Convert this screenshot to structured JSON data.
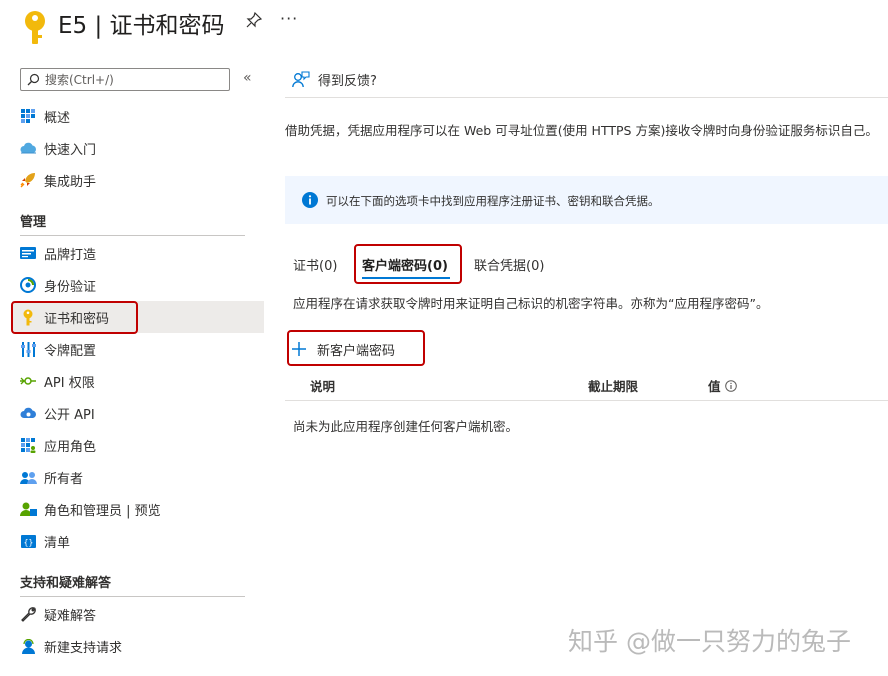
{
  "header": {
    "title": "E5 | 证书和密码",
    "more": "···"
  },
  "sidebar": {
    "search_placeholder": "搜索(Ctrl+/)",
    "collapse": "«",
    "top_items": [
      {
        "label": "概述",
        "icon": "overview-grid-icon"
      },
      {
        "label": "快速入门",
        "icon": "cloud-icon"
      },
      {
        "label": "集成助手",
        "icon": "rocket-icon"
      }
    ],
    "section_manage": "管理",
    "manage_items": [
      {
        "label": "品牌打造",
        "icon": "branding-icon"
      },
      {
        "label": "身份验证",
        "icon": "authentication-icon"
      },
      {
        "label": "证书和密码",
        "icon": "key-icon"
      },
      {
        "label": "令牌配置",
        "icon": "token-config-icon"
      },
      {
        "label": "API 权限",
        "icon": "api-permission-icon"
      },
      {
        "label": "公开 API",
        "icon": "cloud-api-icon"
      },
      {
        "label": "应用角色",
        "icon": "app-roles-icon"
      },
      {
        "label": "所有者",
        "icon": "owners-icon"
      },
      {
        "label": "角色和管理员 | 预览",
        "icon": "roles-admins-icon"
      },
      {
        "label": "清单",
        "icon": "manifest-icon"
      }
    ],
    "section_support": "支持和疑难解答",
    "support_items": [
      {
        "label": "疑难解答",
        "icon": "wrench-icon"
      },
      {
        "label": "新建支持请求",
        "icon": "support-person-icon"
      }
    ]
  },
  "main": {
    "feedback": "得到反馈?",
    "description": "借助凭据，凭据应用程序可以在 Web 可寻址位置(使用 HTTPS 方案)接收令牌时向身份验证服务标识自己。",
    "info": "可以在下面的选项卡中找到应用程序注册证书、密钥和联合凭据。",
    "tabs": [
      {
        "label": "证书(0)"
      },
      {
        "label": "客户端密码(0)"
      },
      {
        "label": "联合凭据(0)"
      }
    ],
    "tab_description": "应用程序在请求获取令牌时用来证明自己标识的机密字符串。亦称为“应用程序密码”。",
    "new_button": "新客户端密码",
    "columns": [
      "说明",
      "截止期限",
      "值"
    ],
    "empty_message": "尚未为此应用程序创建任何客户端机密。"
  },
  "watermark": "知乎 @做一只努力的兔子",
  "colors": {
    "accent": "#0078d4",
    "highlight_box": "#c00000",
    "active_nav": "#edebe9",
    "info_bg": "#f0f6ff",
    "key_yellow": "#f2b90c"
  }
}
